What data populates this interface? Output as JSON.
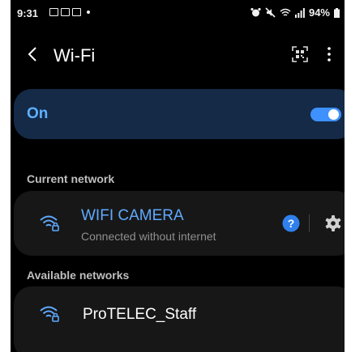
{
  "status_bar": {
    "time": "9:31",
    "battery": "94%"
  },
  "appbar": {
    "title": "Wi-Fi"
  },
  "wifi_toggle": {
    "label": "On",
    "enabled": true
  },
  "current_network": {
    "header": "Current network",
    "name": "WIFI CAMERA",
    "status": "Connected without internet"
  },
  "available_networks": {
    "header": "Available networks",
    "items": [
      {
        "name": "ProTELEC_Staff"
      }
    ]
  },
  "colors": {
    "accent": "#3e91ff",
    "toggle_text": "#5fb0ff",
    "toggle_card": "#142a47",
    "connected_name": "#5fa9ff",
    "card_bg": "#171717",
    "background": "#000000"
  }
}
